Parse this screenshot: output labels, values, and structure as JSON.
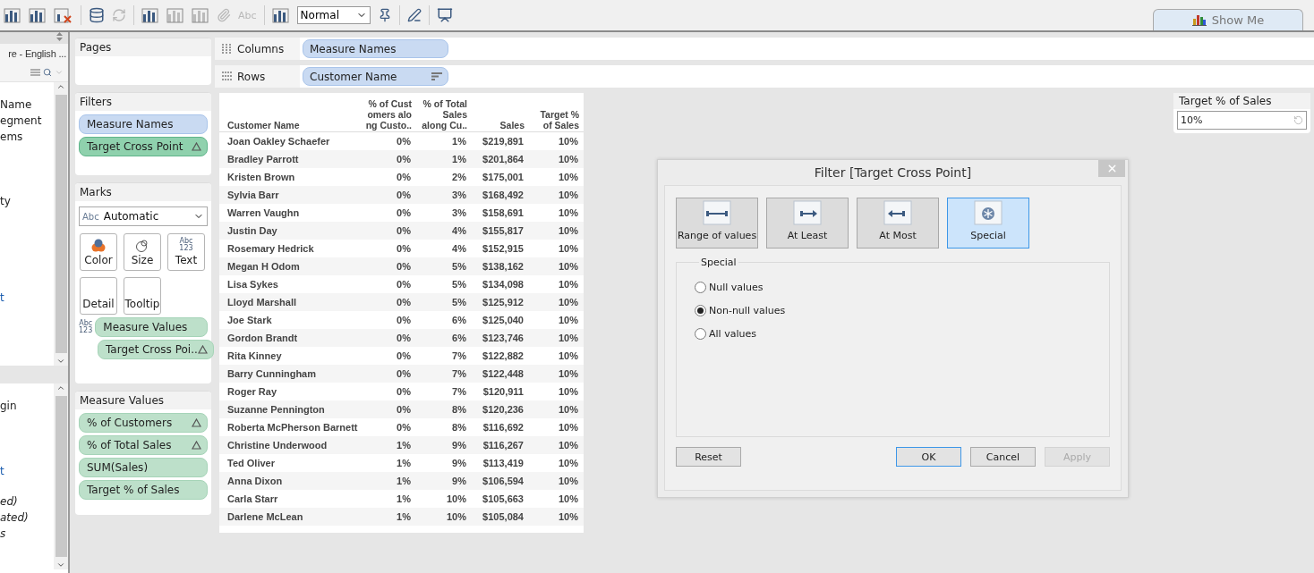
{
  "toolbar": {
    "format_label": "Abc",
    "view_size": "Normal",
    "show_me": "Show Me"
  },
  "data_pane": {
    "source": "re - English ...",
    "upper_items": [
      {
        "text": "Name",
        "kind": "dimension"
      },
      {
        "text": "egment",
        "kind": "dimension"
      },
      {
        "text": "ems",
        "kind": "dimension"
      },
      {
        "text": "ty",
        "kind": "dimension"
      },
      {
        "text": "t",
        "kind": "hierarchy"
      }
    ],
    "lower_items": [
      {
        "text": "gin",
        "kind": "measure"
      },
      {
        "text": "t",
        "kind": "hierarchy"
      },
      {
        "text": "ed)",
        "kind": "generated"
      },
      {
        "text": "ated)",
        "kind": "generated"
      },
      {
        "text": "s",
        "kind": "generated"
      }
    ]
  },
  "pages": {
    "title": "Pages"
  },
  "filters": {
    "title": "Filters",
    "pills": [
      {
        "text": "Measure Names",
        "kind": "dimension",
        "calculated": false,
        "selected": false
      },
      {
        "text": "Target Cross Point",
        "kind": "measure",
        "calculated": true,
        "selected": true
      }
    ]
  },
  "marks": {
    "title": "Marks",
    "type_icon": "Abc",
    "type": "Automatic",
    "cards": [
      {
        "label": "Color",
        "kind": "color"
      },
      {
        "label": "Size",
        "kind": "size"
      },
      {
        "label": "Text",
        "kind": "text"
      },
      {
        "label": "Detail",
        "kind": "detail"
      },
      {
        "label": "Tooltip",
        "kind": "tooltip"
      }
    ],
    "text_icon": [
      "Abc",
      "123"
    ],
    "field_icon": [
      "Abc",
      "123"
    ],
    "fields": [
      {
        "text": "Measure Values",
        "calculated": false
      },
      {
        "text": "Target Cross Poi..",
        "calculated": true
      }
    ]
  },
  "measure_values": {
    "title": "Measure Values",
    "pills": [
      {
        "text": "% of Customers",
        "calculated": true
      },
      {
        "text": "% of Total Sales",
        "calculated": true
      },
      {
        "text": "SUM(Sales)",
        "calculated": false
      },
      {
        "text": "Target % of Sales",
        "calculated": false
      }
    ]
  },
  "columns_shelf": {
    "label": "Columns",
    "pill": "Measure Names"
  },
  "rows_shelf": {
    "label": "Rows",
    "pill": "Customer Name"
  },
  "table": {
    "columns": [
      "Customer Name",
      "% of Cust omers alo ng Custo..",
      "% of Total Sales along Cu..",
      "Sales",
      "Target % of Sales"
    ],
    "rows": [
      [
        "Joan Oakley Schaefer",
        "0%",
        "1%",
        "$219,891",
        "10%"
      ],
      [
        "Bradley Parrott",
        "0%",
        "1%",
        "$201,864",
        "10%"
      ],
      [
        "Kristen Brown",
        "0%",
        "2%",
        "$175,001",
        "10%"
      ],
      [
        "Sylvia Barr",
        "0%",
        "3%",
        "$168,492",
        "10%"
      ],
      [
        "Warren Vaughn",
        "0%",
        "3%",
        "$158,691",
        "10%"
      ],
      [
        "Justin Day",
        "0%",
        "4%",
        "$155,817",
        "10%"
      ],
      [
        "Rosemary Hedrick",
        "0%",
        "4%",
        "$152,915",
        "10%"
      ],
      [
        "Megan H Odom",
        "0%",
        "5%",
        "$138,162",
        "10%"
      ],
      [
        "Lisa Sykes",
        "0%",
        "5%",
        "$134,098",
        "10%"
      ],
      [
        "Lloyd Marshall",
        "0%",
        "5%",
        "$125,912",
        "10%"
      ],
      [
        "Joe Stark",
        "0%",
        "6%",
        "$125,040",
        "10%"
      ],
      [
        "Gordon Brandt",
        "0%",
        "6%",
        "$123,746",
        "10%"
      ],
      [
        "Rita Kinney",
        "0%",
        "7%",
        "$122,882",
        "10%"
      ],
      [
        "Barry Cunningham",
        "0%",
        "7%",
        "$122,448",
        "10%"
      ],
      [
        "Roger Ray",
        "0%",
        "7%",
        "$120,911",
        "10%"
      ],
      [
        "Suzanne Pennington",
        "0%",
        "8%",
        "$120,236",
        "10%"
      ],
      [
        "Roberta McPherson Barnett",
        "0%",
        "8%",
        "$116,692",
        "10%"
      ],
      [
        "Christine Underwood",
        "1%",
        "9%",
        "$116,267",
        "10%"
      ],
      [
        "Ted Oliver",
        "1%",
        "9%",
        "$113,419",
        "10%"
      ],
      [
        "Anna Dixon",
        "1%",
        "9%",
        "$106,594",
        "10%"
      ],
      [
        "Carla Starr",
        "1%",
        "10%",
        "$105,663",
        "10%"
      ],
      [
        "Darlene McLean",
        "1%",
        "10%",
        "$105,084",
        "10%"
      ]
    ]
  },
  "parameter": {
    "title": "Target % of Sales",
    "value": "10%"
  },
  "dialog": {
    "title": "Filter [Target Cross Point]",
    "tabs": [
      {
        "label": "Range of values",
        "kind": "range",
        "selected": false
      },
      {
        "label": "At Least",
        "kind": "least",
        "selected": false
      },
      {
        "label": "At Most",
        "kind": "most",
        "selected": false
      },
      {
        "label": "Special",
        "kind": "special",
        "selected": true
      }
    ],
    "group_title": "Special",
    "options": [
      {
        "label": "Null values",
        "selected": false
      },
      {
        "label": "Non-null values",
        "selected": true
      },
      {
        "label": "All values",
        "selected": false
      }
    ],
    "buttons": [
      {
        "label": "Reset",
        "kind": "normal"
      },
      {
        "label": "OK",
        "kind": "default"
      },
      {
        "label": "Cancel",
        "kind": "normal"
      },
      {
        "label": "Apply",
        "kind": "disabled"
      }
    ]
  }
}
